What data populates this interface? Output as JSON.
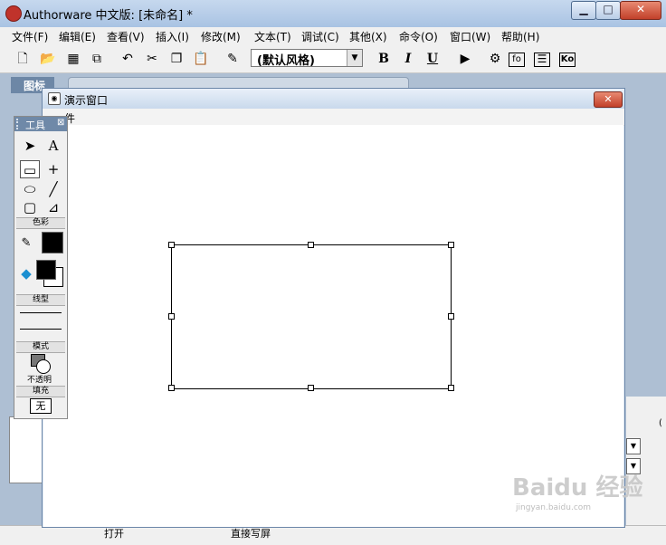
{
  "app": {
    "title": "Authorware 中文版: [未命名] *"
  },
  "window_controls": {
    "minimize": "▁",
    "maximize": "□",
    "close": "✕"
  },
  "menu": [
    "文件(F)",
    "编辑(E)",
    "查看(V)",
    "插入(I)",
    "修改(M)",
    "文本(T)",
    "调试(C)",
    "其他(X)",
    "命令(O)",
    "窗口(W)",
    "帮助(H)"
  ],
  "toolbar": {
    "style_select": "(默认风格)",
    "bold": "B",
    "italic": "I",
    "underline": "U",
    "icons": [
      "new-file-icon",
      "open-folder-icon",
      "save-all-icon",
      "import-icon",
      "undo-icon",
      "cut-icon",
      "copy-icon",
      "paste-icon",
      "find-icon",
      "run-icon",
      "control-panel-icon",
      "functions-icon",
      "variables-icon",
      "knowledge-objects-icon"
    ],
    "fn_label": "fo",
    "ko_label": "Ko"
  },
  "icon_panel": {
    "title": "图标"
  },
  "presentation": {
    "title": "演示窗口",
    "menu_item": "件"
  },
  "tools": {
    "title": "工具",
    "color_section": "色彩",
    "linestyle_section": "线型",
    "mode_section": "模式",
    "mode_value": "不透明",
    "fill_section": "填充",
    "fill_value": "无"
  },
  "background": {
    "direct_label": "直接写屏",
    "open_label": "打开",
    "right_label": "("
  },
  "watermark": {
    "text": "Baidu 经验",
    "sub": "jingyan.baidu.com"
  },
  "colors": {
    "title_gradient": "#b9cde6",
    "tools_header": "#6f89a8",
    "close_red": "#c2402a"
  }
}
